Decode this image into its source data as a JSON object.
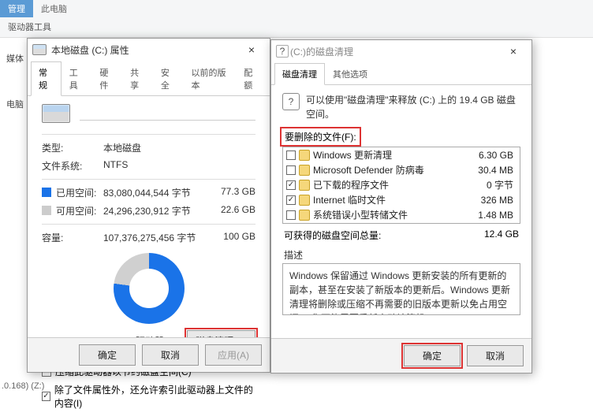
{
  "ribbon": {
    "tab_manage": "管理",
    "tab_thispc": "此电脑",
    "sub_drive_tools": "驱动器工具"
  },
  "bg": {
    "nav_media": "媒体",
    "nav_pc": "电脑"
  },
  "status_bar": ".0.168) (Z:)",
  "props": {
    "title": "本地磁盘 (C:) 属性",
    "tabs": [
      "常规",
      "工具",
      "硬件",
      "共享",
      "安全",
      "以前的版本",
      "配额"
    ],
    "type_label": "类型:",
    "type_value": "本地磁盘",
    "fs_label": "文件系统:",
    "fs_value": "NTFS",
    "used_label": "已用空间:",
    "used_bytes": "83,080,044,544 字节",
    "used_gb": "77.3 GB",
    "free_label": "可用空间:",
    "free_bytes": "24,296,230,912 字节",
    "free_gb": "22.6 GB",
    "cap_label": "容量:",
    "cap_bytes": "107,376,275,456 字节",
    "cap_gb": "100 GB",
    "drive_label": "驱动器 C:",
    "cleanup_btn": "磁盘清理(D)",
    "compress_cb": "压缩此驱动器以节约磁盘空间(C)",
    "index_cb": "除了文件属性外，还允许索引此驱动器上文件的内容(I)",
    "ok": "确定",
    "cancel": "取消",
    "apply": "应用(A)"
  },
  "cleanup": {
    "title": "(C:)的磁盘清理",
    "tabs": [
      "磁盘清理",
      "其他选项"
    ],
    "info_text": "可以使用\"磁盘清理\"来释放  (C:) 上的 19.4 GB 磁盘空间。",
    "files_label": "要删除的文件(F):",
    "items": [
      {
        "checked": false,
        "name": "Windows 更新清理",
        "size": "6.30 GB"
      },
      {
        "checked": false,
        "name": "Microsoft Defender 防病毒",
        "size": "30.4 MB"
      },
      {
        "checked": true,
        "name": "已下载的程序文件",
        "size": "0 字节"
      },
      {
        "checked": true,
        "name": "Internet 临时文件",
        "size": "326 MB"
      },
      {
        "checked": false,
        "name": "系统错误小型转储文件",
        "size": "1.48 MB"
      }
    ],
    "gain_label": "可获得的磁盘空间总量:",
    "gain_value": "12.4 GB",
    "desc_label": "描述",
    "desc_text": "Windows 保留通过 Windows 更新安装的所有更新的副本，甚至在安装了新版本的更新后。Windows 更新清理将删除或压缩不再需要的旧版本更新以免占用空间。(你可能需要重新启动计算机。)",
    "ok": "确定",
    "cancel": "取消"
  }
}
